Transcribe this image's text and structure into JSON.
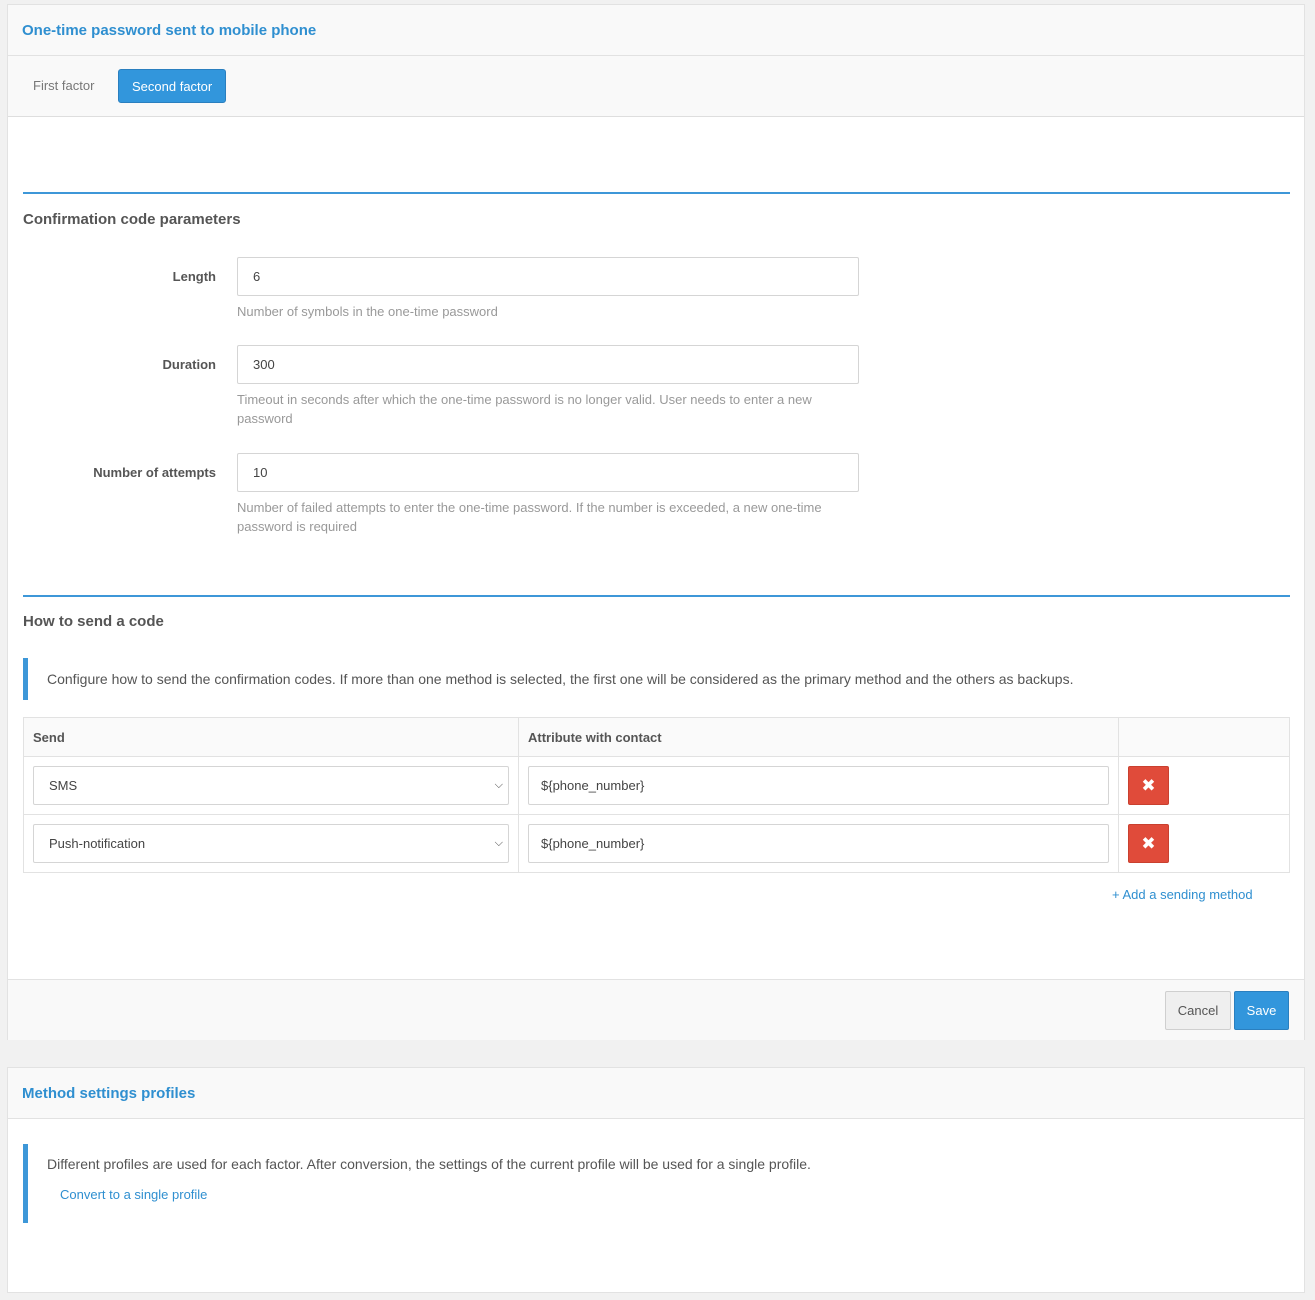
{
  "otp_panel": {
    "title": "One-time password sent to mobile phone",
    "tabs": [
      {
        "label": "First factor",
        "active": false
      },
      {
        "label": "Second factor",
        "active": true
      }
    ],
    "code_params": {
      "title": "Confirmation code parameters",
      "length": {
        "label": "Length",
        "value": "6",
        "help": "Number of symbols in the one-time password"
      },
      "duration": {
        "label": "Duration",
        "value": "300",
        "help": "Timeout in seconds after which the one-time password is no longer valid. User needs to enter a new password"
      },
      "attempts": {
        "label": "Number of attempts",
        "value": "10",
        "help": "Number of failed attempts to enter the one-time password. If the number is exceeded, a new one-time password is required"
      }
    },
    "send": {
      "title": "How to send a code",
      "info": "Configure how to send the confirmation codes. If more than one method is selected, the first one will be considered as the primary method and the others as backups.",
      "columns": {
        "send": "Send",
        "attribute": "Attribute with contact"
      },
      "rows": [
        {
          "method": "SMS",
          "attribute": "${phone_number}"
        },
        {
          "method": "Push-notification",
          "attribute": "${phone_number}"
        }
      ],
      "add_link": "+ Add a sending method",
      "delete_glyph": "✖",
      "chevron_glyph": "⌵"
    },
    "footer": {
      "cancel": "Cancel",
      "save": "Save"
    }
  },
  "profiles_panel": {
    "title": "Method settings profiles",
    "info": "Different profiles are used for each factor. After conversion, the settings of the current profile will be used for a single profile.",
    "convert_link": "Convert to a single profile"
  },
  "colors": {
    "accent": "#3296dc",
    "title_blue": "#2f8fd0",
    "danger": "#e04b3a"
  }
}
